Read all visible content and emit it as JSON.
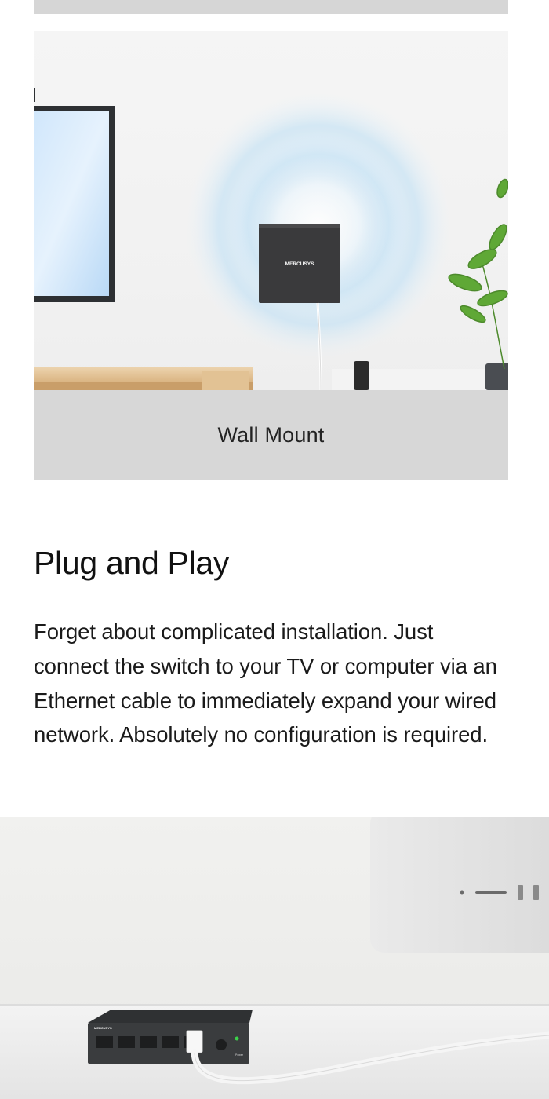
{
  "wall_mount": {
    "caption": "Wall Mount",
    "device_brand": "MERCUSYS"
  },
  "plug_and_play": {
    "title": "Plug and Play",
    "body": "Forget about complicated installation. Just connect the switch to your TV or computer via an Ethernet cable to immediately expand your wired network. Absolutely no configuration is required."
  },
  "switch_photo": {
    "brand": "MERCUSYS",
    "power_label": "Power"
  },
  "colors": {
    "caption_band": "#d7d7d7",
    "top_strip": "#d6d6d6",
    "wifi_glow": "#bfe0f5",
    "device_body": "#3a3a3c",
    "led_green": "#3cd24a"
  }
}
